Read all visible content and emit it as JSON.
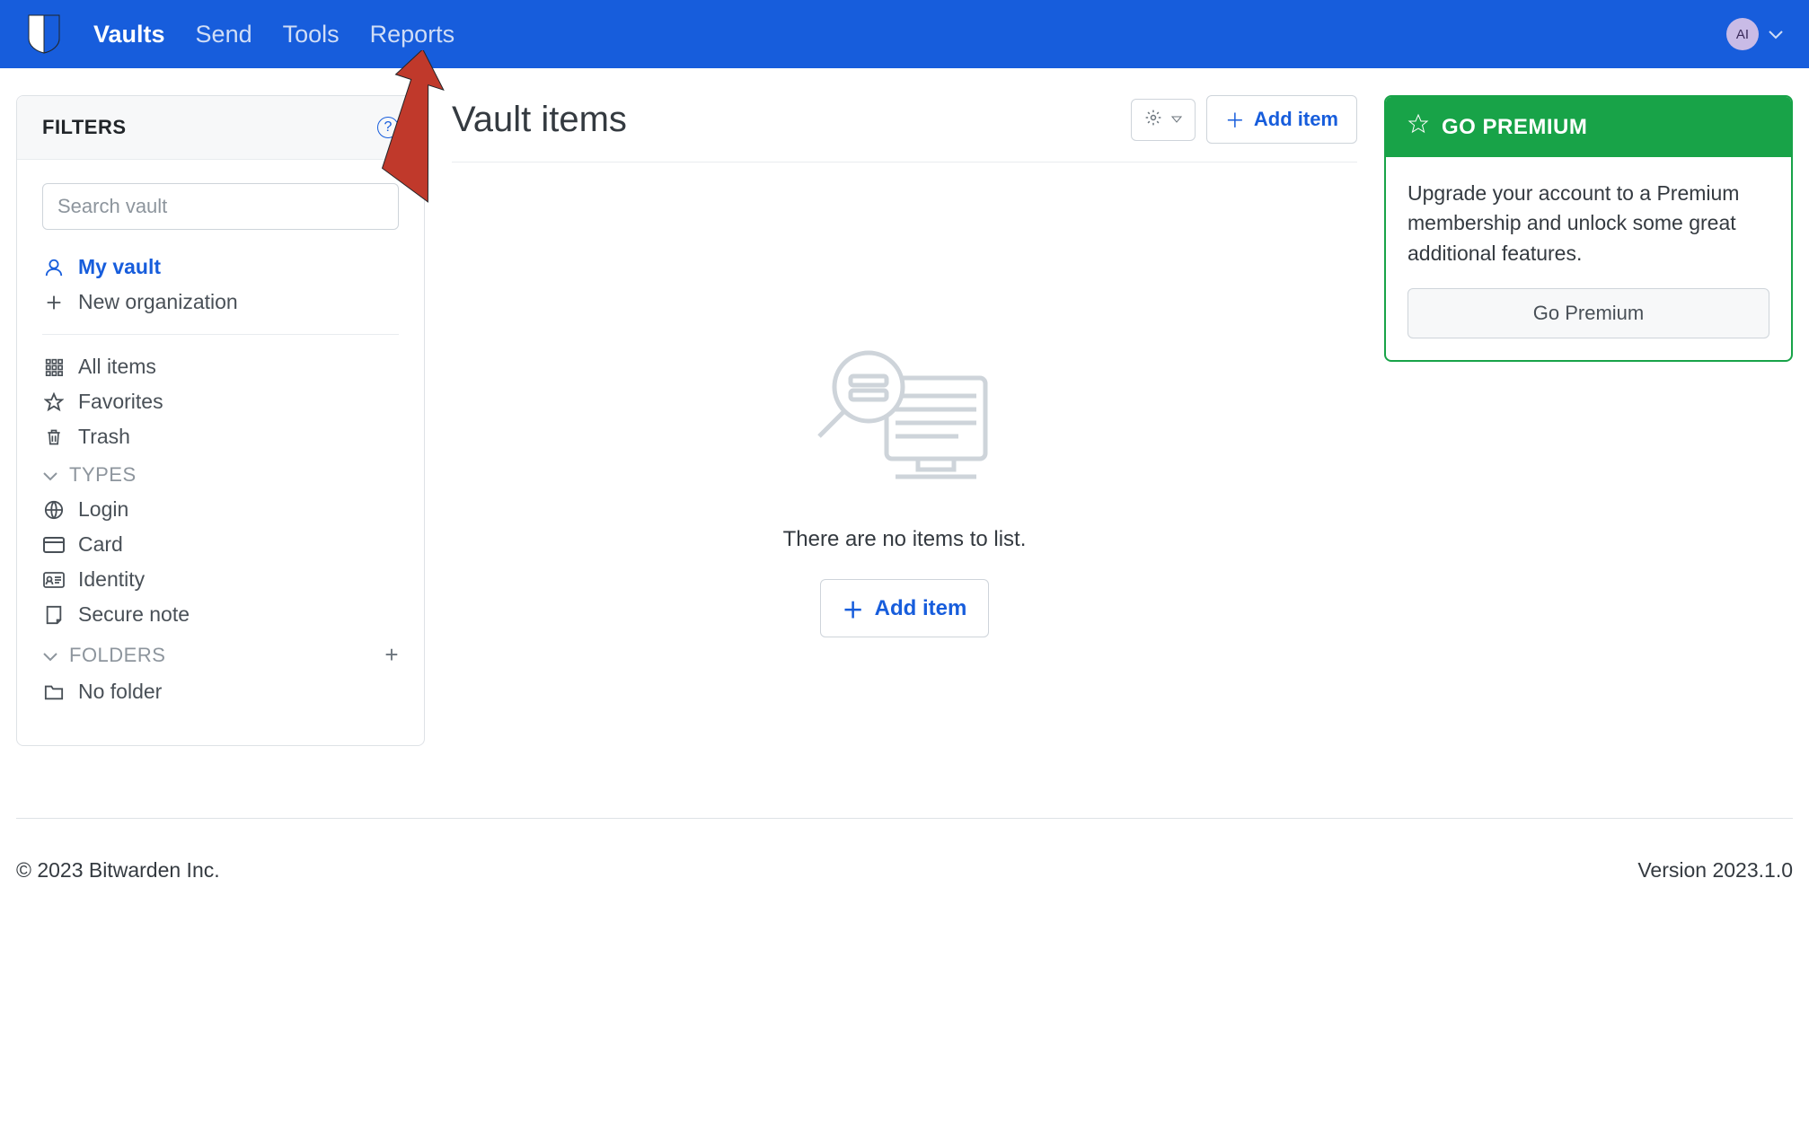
{
  "topbar": {
    "nav": [
      "Vaults",
      "Send",
      "Tools",
      "Reports"
    ],
    "active_index": 0,
    "avatar_initials": "AI"
  },
  "filters": {
    "title": "FILTERS",
    "search_placeholder": "Search vault",
    "vault_items": [
      {
        "icon": "user-icon",
        "label": "My vault",
        "active": true
      },
      {
        "icon": "plus-icon",
        "label": "New organization",
        "active": false
      }
    ],
    "item_groups": [
      {
        "icon": "grid-icon",
        "label": "All items"
      },
      {
        "icon": "star-icon",
        "label": "Favorites"
      },
      {
        "icon": "trash-icon",
        "label": "Trash"
      }
    ],
    "types_heading": "TYPES",
    "types": [
      {
        "icon": "globe-icon",
        "label": "Login"
      },
      {
        "icon": "card-icon",
        "label": "Card"
      },
      {
        "icon": "id-icon",
        "label": "Identity"
      },
      {
        "icon": "note-icon",
        "label": "Secure note"
      }
    ],
    "folders_heading": "FOLDERS",
    "folders": [
      {
        "icon": "folder-icon",
        "label": "No folder"
      }
    ]
  },
  "main": {
    "title": "Vault items",
    "add_item_label": "Add item",
    "empty_text": "There are no items to list.",
    "empty_add_label": "Add item"
  },
  "premium": {
    "heading": "GO PREMIUM",
    "body": "Upgrade your account to a Premium membership and unlock some great additional features.",
    "button": "Go Premium"
  },
  "footer": {
    "copyright": "© 2023 Bitwarden Inc.",
    "version": "Version 2023.1.0"
  }
}
